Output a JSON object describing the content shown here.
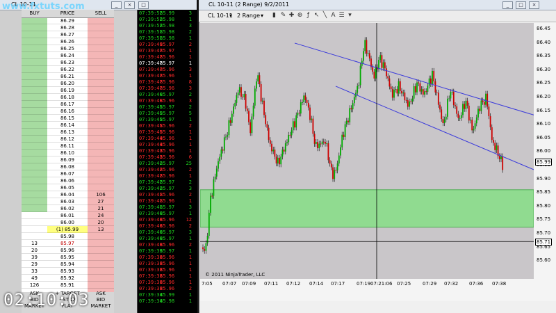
{
  "watermark": "www.fxtuts.com",
  "timer": "02:10:03",
  "dom": {
    "title": "CL 10-11",
    "headers": {
      "buy": "BUY",
      "price": "PRICE",
      "sell": "SELL"
    },
    "prices": [
      "86.29",
      "86.28",
      "86.27",
      "86.26",
      "86.25",
      "86.24",
      "86.23",
      "86.22",
      "86.21",
      "86.20",
      "86.19",
      "86.18",
      "86.17",
      "86.16",
      "86.15",
      "86.14",
      "86.13",
      "86.12",
      "86.11",
      "86.10",
      "86.09",
      "86.08",
      "86.07",
      "86.06",
      "86.05",
      "86.04",
      "86.03",
      "86.02",
      "86.01",
      "86.00",
      "(1) 85.99",
      "85.98",
      "85.97",
      "85.96",
      "85.95",
      "85.94",
      "85.93",
      "85.92",
      "85.91"
    ],
    "ask_sizes": [
      "106",
      "27",
      "21",
      "24",
      "20",
      "13"
    ],
    "bid_sizes": [
      "13",
      "20",
      "39",
      "29",
      "33",
      "49",
      "126"
    ],
    "footer": {
      "ask_l": "ASK",
      "target": "+ TARGET",
      "ask_r": "ASK",
      "bid_l": "BID",
      "stop": "- STOP",
      "bid_r": "BID",
      "market_l": "MARKET",
      "flat": "FLAT",
      "market_r": "MARKET"
    }
  },
  "ts": {
    "rows": [
      [
        "07:39:52",
        "85.99",
        "3",
        "g"
      ],
      [
        "07:39:52",
        "85.98",
        "1",
        "g"
      ],
      [
        "07:39:52",
        "85.98",
        "3",
        "g"
      ],
      [
        "07:39:51",
        "85.98",
        "2",
        "g"
      ],
      [
        "07:39:51",
        "85.98",
        "1",
        "g"
      ],
      [
        "07:39:49",
        "85.97",
        "2",
        "r"
      ],
      [
        "07:39:47",
        "85.97",
        "1",
        "r"
      ],
      [
        "07:39:47",
        "85.96",
        "1",
        "r"
      ],
      [
        "07:39:47",
        "85.97",
        "1",
        "w"
      ],
      [
        "07:39:47",
        "85.96",
        "3",
        "r"
      ],
      [
        "07:39:47",
        "85.96",
        "1",
        "r"
      ],
      [
        "07:39:47",
        "85.96",
        "8",
        "r"
      ],
      [
        "07:39:47",
        "85.96",
        "3",
        "r"
      ],
      [
        "07:39:46",
        "85.97",
        "2",
        "g"
      ],
      [
        "07:39:46",
        "85.96",
        "3",
        "r"
      ],
      [
        "07:39:45",
        "85.97",
        "2",
        "g"
      ],
      [
        "07:39:45",
        "85.97",
        "5",
        "g"
      ],
      [
        "07:39:45",
        "85.97",
        "1",
        "g"
      ],
      [
        "07:39:45",
        "85.96",
        "2",
        "r"
      ],
      [
        "07:39:45",
        "85.96",
        "1",
        "r"
      ],
      [
        "07:39:44",
        "85.96",
        "1",
        "r"
      ],
      [
        "07:39:44",
        "85.96",
        "1",
        "r"
      ],
      [
        "07:39:43",
        "85.96",
        "1",
        "r"
      ],
      [
        "07:39:43",
        "85.96",
        "6",
        "r"
      ],
      [
        "07:39:42",
        "85.97",
        "25",
        "g"
      ],
      [
        "07:39:42",
        "85.96",
        "2",
        "r"
      ],
      [
        "07:39:42",
        "85.96",
        "1",
        "r"
      ],
      [
        "07:39:42",
        "85.97",
        "2",
        "g"
      ],
      [
        "07:39:42",
        "85.97",
        "3",
        "g"
      ],
      [
        "07:39:41",
        "85.96",
        "2",
        "r"
      ],
      [
        "07:39:41",
        "85.96",
        "1",
        "r"
      ],
      [
        "07:39:41",
        "85.97",
        "3",
        "g"
      ],
      [
        "07:39:40",
        "85.97",
        "1",
        "g"
      ],
      [
        "07:39:40",
        "85.96",
        "12",
        "r"
      ],
      [
        "07:39:40",
        "85.96",
        "2",
        "r"
      ],
      [
        "07:39:40",
        "85.97",
        "3",
        "g"
      ],
      [
        "07:39:40",
        "85.97",
        "1",
        "g"
      ],
      [
        "07:39:40",
        "85.96",
        "2",
        "r"
      ],
      [
        "07:39:39",
        "85.97",
        "1",
        "g"
      ],
      [
        "07:39:38",
        "85.96",
        "1",
        "r"
      ],
      [
        "07:39:38",
        "85.96",
        "1",
        "r"
      ],
      [
        "07:39:38",
        "85.96",
        "1",
        "r"
      ],
      [
        "07:39:38",
        "85.96",
        "1",
        "r"
      ],
      [
        "07:39:38",
        "85.96",
        "1",
        "r"
      ],
      [
        "07:39:38",
        "85.96",
        "2",
        "r"
      ],
      [
        "07:39:34",
        "85.99",
        "1",
        "g"
      ],
      [
        "07:39:34",
        "85.98",
        "1",
        "g"
      ]
    ]
  },
  "chart": {
    "title": "CL 10-11 (2 Range)  9/2/2011",
    "toolbar": {
      "instrument": "CL 10-11",
      "period": "2 Range"
    },
    "copyright": "© 2011 NinjaTrader, LLC",
    "price_ticks": [
      "86.45",
      "86.40",
      "86.35",
      "86.30",
      "86.25",
      "86.20",
      "86.15",
      "86.10",
      "86.05",
      "86.00",
      "85.95",
      "85.90",
      "85.85",
      "85.80",
      "85.75",
      "85.70",
      "85.65",
      "85.60"
    ],
    "time_ticks": [
      "7:05",
      "07:07",
      "07:09",
      "07:11",
      "07:12",
      "07:14",
      "07:17",
      "07:19",
      "07:21:06",
      "07:25",
      "07:29",
      "07:32",
      "07:36",
      "07:38"
    ],
    "last_price": "85.99",
    "line_price": "85.71"
  },
  "chart_data": {
    "type": "candlestick",
    "ylim": [
      85.58,
      86.47
    ],
    "channel_upper": [
      [
        0.2,
        86.4
      ],
      [
        1.0,
        86.15
      ]
    ],
    "channel_lower": [
      [
        0.02,
        86.25
      ],
      [
        1.0,
        85.96
      ]
    ],
    "zone": [
      85.76,
      85.89
    ],
    "colors": {
      "up": "#00aa00",
      "down": "#cc0000",
      "zone": "#7ce27c",
      "channel": "#3a3adb"
    }
  }
}
